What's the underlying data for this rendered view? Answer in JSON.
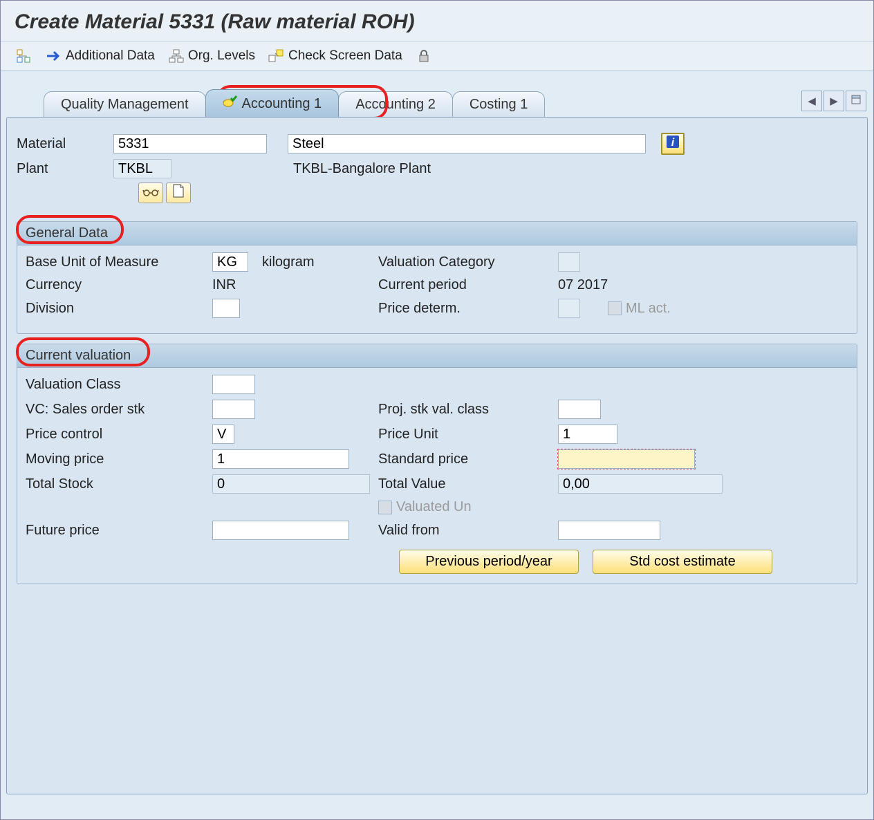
{
  "title": "Create Material 5331 (Raw material ROH)",
  "toolbar": {
    "additional_data": "Additional Data",
    "org_levels": "Org. Levels",
    "check_screen": "Check Screen Data"
  },
  "tabs": {
    "quality": "Quality Management",
    "acct1": "Accounting 1",
    "acct2": "Accounting 2",
    "cost1": "Costing 1"
  },
  "header": {
    "material_label": "Material",
    "material_value": "5331",
    "material_desc": "Steel",
    "plant_label": "Plant",
    "plant_value": "TKBL",
    "plant_desc": "TKBL-Bangalore Plant"
  },
  "general": {
    "title": "General Data",
    "buom_label": "Base Unit of Measure",
    "buom_val": "KG",
    "buom_text": "kilogram",
    "valcat_label": "Valuation Category",
    "currency_label": "Currency",
    "currency_val": "INR",
    "curperiod_label": "Current period",
    "curperiod_val": "07 2017",
    "division_label": "Division",
    "pricedet_label": "Price determ.",
    "mlact_label": "ML act."
  },
  "valuation": {
    "title": "Current valuation",
    "valclass_label": "Valuation Class",
    "vc_sales_label": "VC: Sales order stk",
    "proj_stk_label": "Proj. stk val. class",
    "price_ctrl_label": "Price control",
    "price_ctrl_val": "V",
    "price_unit_label": "Price Unit",
    "price_unit_val": "1",
    "moving_price_label": "Moving price",
    "moving_price_val": "1",
    "std_price_label": "Standard price",
    "total_stock_label": "Total Stock",
    "total_stock_val": "0",
    "total_value_label": "Total Value",
    "total_value_val": "0,00",
    "valuated_un_label": "Valuated Un",
    "future_price_label": "Future price",
    "valid_from_label": "Valid from",
    "btn_prev": "Previous period/year",
    "btn_est": "Std cost estimate"
  }
}
